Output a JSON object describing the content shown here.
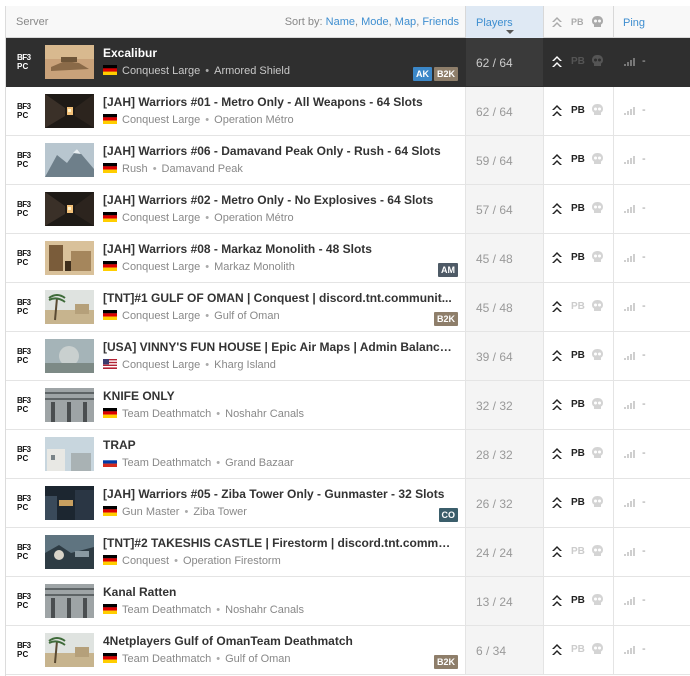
{
  "header": {
    "server_label": "Server",
    "sort_prefix": "Sort by:",
    "sort_options": [
      "Name",
      "Mode",
      "Map",
      "Friends"
    ],
    "players_label": "Players",
    "pb_label": "PB",
    "ping_label": "Ping"
  },
  "colors": {
    "accent": "#3e8ed0",
    "selected_row": "#2f2f2f",
    "players_col": "#f4f4f4"
  },
  "rows": [
    {
      "platform_top": "BF3",
      "platform_bottom": "PC",
      "name": "Excalibur",
      "flag": "de",
      "mode": "Conquest Large",
      "map": "Armored Shield",
      "badges": [
        "AK",
        "B2K"
      ],
      "players": "62 / 64",
      "pb": false,
      "ping": "-",
      "selected": true,
      "thumb": "desert"
    },
    {
      "platform_top": "BF3",
      "platform_bottom": "PC",
      "name": "[JAH] Warriors #01 - Metro Only - All Weapons - 64 Slots",
      "flag": "de",
      "mode": "Conquest Large",
      "map": "Operation Métro",
      "badges": [],
      "players": "62 / 64",
      "pb": true,
      "ping": "-",
      "selected": false,
      "thumb": "metro"
    },
    {
      "platform_top": "BF3",
      "platform_bottom": "PC",
      "name": "[JAH] Warriors #06 - Damavand Peak Only - Rush - 64 Slots",
      "flag": "de",
      "mode": "Rush",
      "map": "Damavand Peak",
      "badges": [],
      "players": "59 / 64",
      "pb": true,
      "ping": "-",
      "selected": false,
      "thumb": "peak"
    },
    {
      "platform_top": "BF3",
      "platform_bottom": "PC",
      "name": "[JAH] Warriors #02 - Metro Only - No Explosives - 64 Slots",
      "flag": "de",
      "mode": "Conquest Large",
      "map": "Operation Métro",
      "badges": [],
      "players": "57 / 64",
      "pb": true,
      "ping": "-",
      "selected": false,
      "thumb": "metro"
    },
    {
      "platform_top": "BF3",
      "platform_bottom": "PC",
      "name": "[JAH] Warriors #08 - Markaz Monolith - 48 Slots",
      "flag": "de",
      "mode": "Conquest Large",
      "map": "Markaz Monolith",
      "badges": [
        "AM"
      ],
      "players": "45 / 48",
      "pb": true,
      "ping": "-",
      "selected": false,
      "thumb": "markaz"
    },
    {
      "platform_top": "BF3",
      "platform_bottom": "PC",
      "name": "[TNT]#1 GULF OF OMAN | Conquest | discord.tnt.communit...",
      "flag": "de",
      "mode": "Conquest Large",
      "map": "Gulf of Oman",
      "badges": [
        "B2K"
      ],
      "players": "45 / 48",
      "pb": false,
      "ping": "-",
      "selected": false,
      "thumb": "oman"
    },
    {
      "platform_top": "BF3",
      "platform_bottom": "PC",
      "name": "[USA] VINNY'S FUN HOUSE | Epic Air Maps | Admin Balance...",
      "flag": "us",
      "mode": "Conquest Large",
      "map": "Kharg Island",
      "badges": [],
      "players": "39 / 64",
      "pb": true,
      "ping": "-",
      "selected": false,
      "thumb": "kharg"
    },
    {
      "platform_top": "BF3",
      "platform_bottom": "PC",
      "name": "KNIFE ONLY",
      "flag": "de",
      "mode": "Team Deathmatch",
      "map": "Noshahr Canals",
      "badges": [],
      "players": "32 / 32",
      "pb": true,
      "ping": "-",
      "selected": false,
      "thumb": "canals"
    },
    {
      "platform_top": "BF3",
      "platform_bottom": "PC",
      "name": "TRAP",
      "flag": "ru",
      "mode": "Team Deathmatch",
      "map": "Grand Bazaar",
      "badges": [],
      "players": "28 / 32",
      "pb": true,
      "ping": "-",
      "selected": false,
      "thumb": "bazaar"
    },
    {
      "platform_top": "BF3",
      "platform_bottom": "PC",
      "name": "[JAH] Warriors #05 - Ziba Tower Only - Gunmaster - 32 Slots",
      "flag": "de",
      "mode": "Gun Master",
      "map": "Ziba Tower",
      "badges": [
        "CO"
      ],
      "players": "26 / 32",
      "pb": true,
      "ping": "-",
      "selected": false,
      "thumb": "ziba"
    },
    {
      "platform_top": "BF3",
      "platform_bottom": "PC",
      "name": "[TNT]#2 TAKESHIS CASTLE | Firestorm | discord.tnt.commu...",
      "flag": "de",
      "mode": "Conquest",
      "map": "Operation Firestorm",
      "badges": [],
      "players": "24 / 24",
      "pb": false,
      "ping": "-",
      "selected": false,
      "thumb": "firestorm"
    },
    {
      "platform_top": "BF3",
      "platform_bottom": "PC",
      "name": "Kanal Ratten",
      "flag": "de",
      "mode": "Team Deathmatch",
      "map": "Noshahr Canals",
      "badges": [],
      "players": "13 / 24",
      "pb": true,
      "ping": "-",
      "selected": false,
      "thumb": "canals"
    },
    {
      "platform_top": "BF3",
      "platform_bottom": "PC",
      "name": "4Netplayers Gulf of OmanTeam Deathmatch",
      "flag": "de",
      "mode": "Team Deathmatch",
      "map": "Gulf of Oman",
      "badges": [
        "B2K"
      ],
      "players": "6 / 34",
      "pb": false,
      "ping": "-",
      "selected": false,
      "thumb": "oman"
    }
  ]
}
